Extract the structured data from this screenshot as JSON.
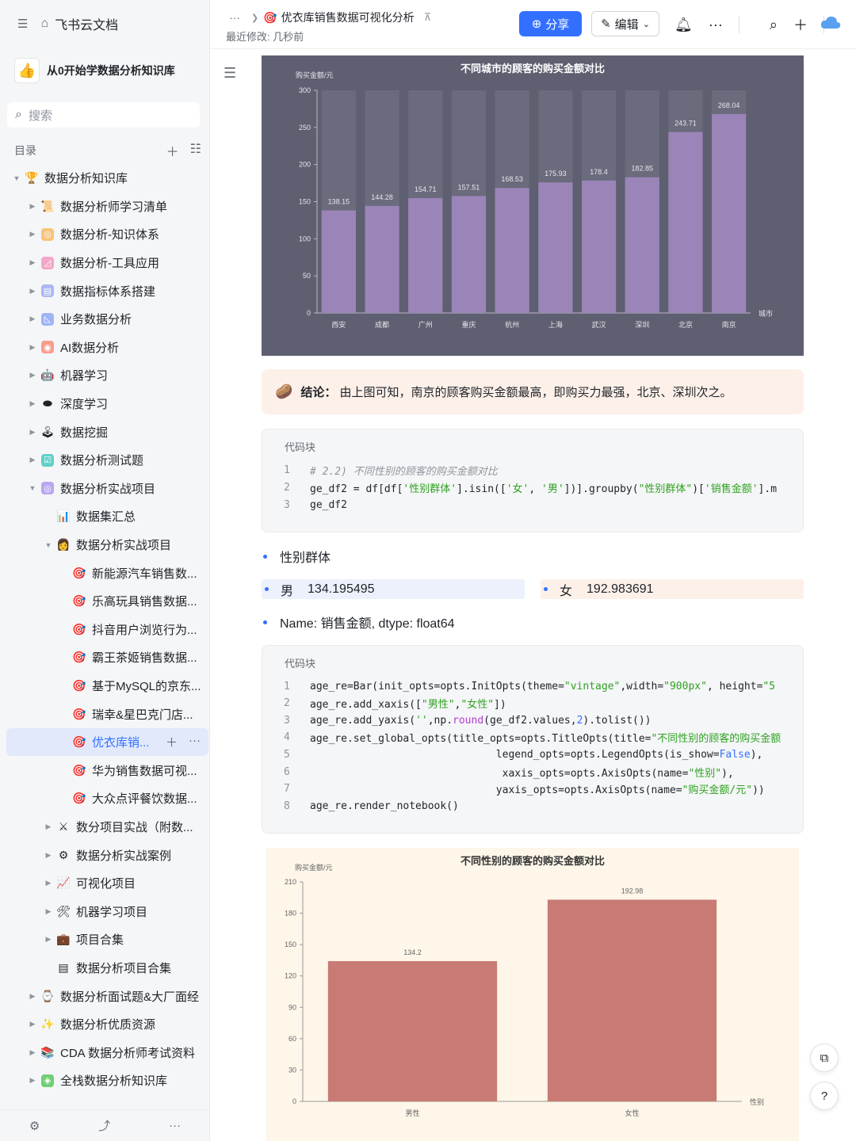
{
  "app": {
    "name": "飞书云文档"
  },
  "knowledge_base": {
    "name": "从0开始学数据分析知识库"
  },
  "search": {
    "placeholder": "搜索"
  },
  "toc": {
    "label": "目录"
  },
  "tree": [
    {
      "label": "数据分析知识库",
      "icon": "trophy-icon",
      "glyph": "🏆",
      "depth": 0,
      "caret": "open",
      "active": false,
      "bg": ""
    },
    {
      "label": "数据分析师学习清单",
      "icon": "scroll-icon",
      "glyph": "📜",
      "depth": 1,
      "caret": "closed",
      "active": false,
      "bg": ""
    },
    {
      "label": "数据分析-知识体系",
      "icon": "web-icon",
      "glyph": "◎",
      "depth": 1,
      "caret": "closed",
      "active": false,
      "bg": "#f8c37a"
    },
    {
      "label": "数据分析-工具应用",
      "icon": "chart-icon",
      "glyph": "◿",
      "depth": 1,
      "caret": "closed",
      "active": false,
      "bg": "#f4a6c8"
    },
    {
      "label": "数据指标体系搭建",
      "icon": "board-icon",
      "glyph": "▤",
      "depth": 1,
      "caret": "closed",
      "active": false,
      "bg": "#a9b8f5"
    },
    {
      "label": "业务数据分析",
      "icon": "line-chart-icon",
      "glyph": "◺",
      "depth": 1,
      "caret": "closed",
      "active": false,
      "bg": "#9fb4f7"
    },
    {
      "label": "AI数据分析",
      "icon": "ai-icon",
      "glyph": "◉",
      "depth": 1,
      "caret": "closed",
      "active": false,
      "bg": "#f79d8e"
    },
    {
      "label": "机器学习",
      "icon": "robot-icon",
      "glyph": "🤖",
      "depth": 1,
      "caret": "closed",
      "active": false,
      "bg": ""
    },
    {
      "label": "深度学习",
      "icon": "disc-icon",
      "glyph": "⬬",
      "depth": 1,
      "caret": "closed",
      "active": false,
      "bg": ""
    },
    {
      "label": "数据挖掘",
      "icon": "joystick-icon",
      "glyph": "🕹",
      "depth": 1,
      "caret": "closed",
      "active": false,
      "bg": ""
    },
    {
      "label": "数据分析测试题",
      "icon": "test-icon",
      "glyph": "☑",
      "depth": 1,
      "caret": "closed",
      "active": false,
      "bg": "#5fd0c8"
    },
    {
      "label": "数据分析实战项目",
      "icon": "project-icon",
      "glyph": "◎",
      "depth": 1,
      "caret": "open",
      "active": false,
      "bg": "#b9a6f2"
    },
    {
      "label": "数据集汇总",
      "icon": "bar-chart-icon",
      "glyph": "📊",
      "depth": 2,
      "caret": "",
      "active": false,
      "bg": ""
    },
    {
      "label": "数据分析实战项目",
      "icon": "person-icon",
      "glyph": "👩",
      "depth": 2,
      "caret": "open",
      "active": false,
      "bg": ""
    },
    {
      "label": "新能源汽车销售数...",
      "icon": "target-icon",
      "glyph": "🎯",
      "depth": 3,
      "caret": "",
      "active": false,
      "bg": ""
    },
    {
      "label": "乐高玩具销售数据...",
      "icon": "target-icon",
      "glyph": "🎯",
      "depth": 3,
      "caret": "",
      "active": false,
      "bg": ""
    },
    {
      "label": "抖音用户浏览行为...",
      "icon": "target-icon",
      "glyph": "🎯",
      "depth": 3,
      "caret": "",
      "active": false,
      "bg": ""
    },
    {
      "label": "霸王茶姬销售数据...",
      "icon": "target-icon",
      "glyph": "🎯",
      "depth": 3,
      "caret": "",
      "active": false,
      "bg": ""
    },
    {
      "label": "基于MySQL的京东...",
      "icon": "target-icon",
      "glyph": "🎯",
      "depth": 3,
      "caret": "",
      "active": false,
      "bg": ""
    },
    {
      "label": "瑞幸&星巴克门店...",
      "icon": "target-icon",
      "glyph": "🎯",
      "depth": 3,
      "caret": "",
      "active": false,
      "bg": ""
    },
    {
      "label": "优衣库销...",
      "icon": "target-icon",
      "glyph": "🎯",
      "depth": 3,
      "caret": "",
      "active": true,
      "bg": ""
    },
    {
      "label": "华为销售数据可视...",
      "icon": "target-icon",
      "glyph": "🎯",
      "depth": 3,
      "caret": "",
      "active": false,
      "bg": ""
    },
    {
      "label": "大众点评餐饮数据...",
      "icon": "target-icon",
      "glyph": "🎯",
      "depth": 3,
      "caret": "",
      "active": false,
      "bg": ""
    },
    {
      "label": "数分项目实战（附数...",
      "icon": "swords-icon",
      "glyph": "⚔",
      "depth": 2,
      "caret": "closed",
      "active": false,
      "bg": ""
    },
    {
      "label": "数据分析实战案例",
      "icon": "gear-icon",
      "glyph": "⚙",
      "depth": 2,
      "caret": "closed",
      "active": false,
      "bg": ""
    },
    {
      "label": "可视化项目",
      "icon": "trend-icon",
      "glyph": "📈",
      "depth": 2,
      "caret": "closed",
      "active": false,
      "bg": ""
    },
    {
      "label": "机器学习项目",
      "icon": "tools-icon",
      "glyph": "🛠",
      "depth": 2,
      "caret": "closed",
      "active": false,
      "bg": ""
    },
    {
      "label": "项目合集",
      "icon": "briefcase-icon",
      "glyph": "💼",
      "depth": 2,
      "caret": "closed",
      "active": false,
      "bg": ""
    },
    {
      "label": "数据分析项目合集",
      "icon": "doc-icon",
      "glyph": "▤",
      "depth": 2,
      "caret": "",
      "active": false,
      "bg": ""
    },
    {
      "label": "数据分析面试题&大厂面经",
      "icon": "watch-icon",
      "glyph": "⌚",
      "depth": 1,
      "caret": "closed",
      "active": false,
      "bg": ""
    },
    {
      "label": "数据分析优质资源",
      "icon": "sparkle-icon",
      "glyph": "✨",
      "depth": 1,
      "caret": "closed",
      "active": false,
      "bg": ""
    },
    {
      "label": "CDA 数据分析师考试资料",
      "icon": "books-icon",
      "glyph": "📚",
      "depth": 1,
      "caret": "closed",
      "active": false,
      "bg": ""
    },
    {
      "label": "全栈数据分析知识库",
      "icon": "stack-icon",
      "glyph": "◈",
      "depth": 1,
      "caret": "closed",
      "active": false,
      "bg": "#6fcf74"
    }
  ],
  "header": {
    "ellipsis": "···",
    "doc_title": "优衣库销售数据可视化分析",
    "last_modified": "最近修改: 几秒前",
    "share_label": "分享",
    "edit_label": "编辑"
  },
  "conclusion": {
    "label": "结论：",
    "text": "由上图可知，南京的顾客购买金额最高，即购买力最强，北京、深圳次之。"
  },
  "codeblock1": {
    "title": "代码块",
    "lines": [
      {
        "n": "1",
        "code": "# 2.2) 不同性别的顾客的购买金额对比"
      },
      {
        "n": "2",
        "code": "ge_df2 = df[df['性别群体'].isin(['女', '男'])].groupby(\"性别群体\")['销售金额'].m"
      },
      {
        "n": "3",
        "code": "ge_df2"
      }
    ]
  },
  "output": {
    "index_name": "性别群体",
    "male_key": "男",
    "male_value": "134.195495",
    "female_key": "女",
    "female_value": "192.983691",
    "footer": "Name: 销售金额, dtype: float64"
  },
  "codeblock2": {
    "title": "代码块",
    "lines": [
      {
        "n": "1",
        "code": "age_re=Bar(init_opts=opts.InitOpts(theme=\"vintage\",width=\"900px\", height=\"5"
      },
      {
        "n": "2",
        "code": "age_re.add_xaxis([\"男性\",\"女性\"])"
      },
      {
        "n": "3",
        "code": "age_re.add_yaxis('',np.round(ge_df2.values,2).tolist())"
      },
      {
        "n": "4",
        "code": "age_re.set_global_opts(title_opts=opts.TitleOpts(title=\"不同性别的顾客的购买金额"
      },
      {
        "n": "5",
        "code": "                              legend_opts=opts.LegendOpts(is_show=False),"
      },
      {
        "n": "6",
        "code": "                               xaxis_opts=opts.AxisOpts(name=\"性别\"),"
      },
      {
        "n": "7",
        "code": "                              yaxis_opts=opts.AxisOpts(name=\"购买金额/元\"))"
      },
      {
        "n": "8",
        "code": "age_re.render_notebook()"
      }
    ]
  },
  "chart_data": [
    {
      "type": "bar",
      "title": "不同城市的顾客的购买金额对比",
      "ylabel": "购买金额/元",
      "xlabel": "城市",
      "categories": [
        "西安",
        "成都",
        "广州",
        "重庆",
        "杭州",
        "上海",
        "武汉",
        "深圳",
        "北京",
        "南京"
      ],
      "values": [
        138.15,
        144.28,
        154.71,
        157.51,
        168.53,
        175.93,
        178.4,
        182.85,
        243.71,
        268.04
      ],
      "value_labels": [
        "138.15",
        "144.28",
        "154.71",
        "157.51",
        "168.53",
        "175.93",
        "178.4",
        "182.85",
        "243.71",
        "268.04"
      ],
      "ylim": [
        0,
        300
      ],
      "yticks": [
        "0",
        "50",
        "100",
        "150",
        "200",
        "250",
        "300"
      ],
      "grid": false,
      "colors": {
        "background": "#5e5f70",
        "bar": "#9b85b8"
      }
    },
    {
      "type": "bar",
      "title": "不同性别的顾客的购买金额对比",
      "ylabel": "购买金额/元",
      "xlabel": "性别",
      "categories": [
        "男性",
        "女性"
      ],
      "values": [
        134.2,
        192.98
      ],
      "value_labels": [
        "134.2",
        "192.98"
      ],
      "ylim": [
        0,
        210
      ],
      "yticks": [
        "0",
        "30",
        "60",
        "90",
        "120",
        "150",
        "180",
        "210"
      ],
      "grid": false,
      "colors": {
        "background": "#fdf6e9",
        "bar": "#c97a74"
      }
    }
  ],
  "colors": {
    "accent": "#3370ff",
    "active_bg": "#e1e9fb",
    "conclusion_bg": "#fdf0e9"
  }
}
